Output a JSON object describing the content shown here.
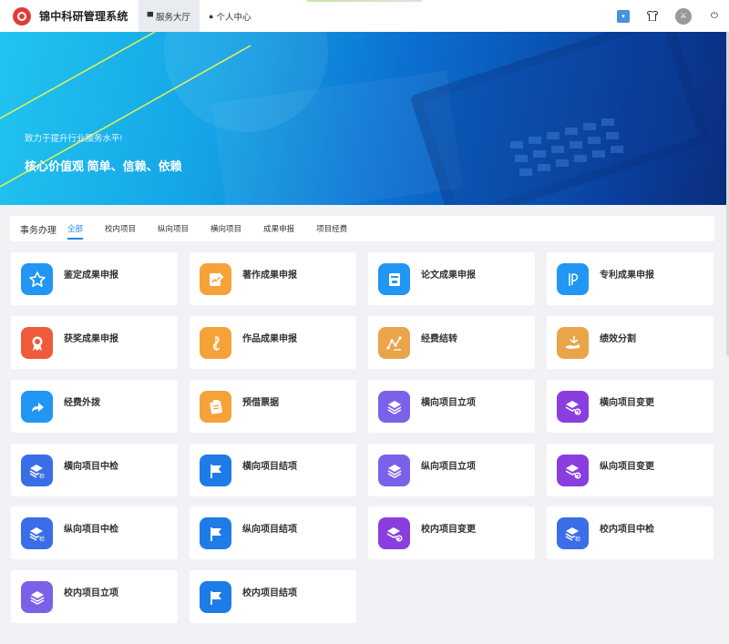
{
  "app": {
    "title": "锦中科研管理系统"
  },
  "nav": [
    {
      "label": "服务大厅",
      "icon": "monitor-icon",
      "active": true
    },
    {
      "label": "个人中心",
      "icon": "user-icon",
      "active": false
    }
  ],
  "header_icons": [
    "dropdown-box-icon",
    "shirt-icon",
    "avatar",
    "power-icon"
  ],
  "banner": {
    "subtitle": "致力于提升行业服务水平!",
    "headline": "核心价值观 简单、信赖、依赖"
  },
  "tabs": {
    "title": "事务办理",
    "filters": [
      "全部",
      "校内项目",
      "纵向项目",
      "横向项目",
      "成果申报",
      "项目经费"
    ],
    "active_index": 0
  },
  "services": [
    {
      "label": "鉴定成果申报",
      "icon": "star-icon",
      "color": "#2196f3"
    },
    {
      "label": "著作成果申报",
      "icon": "edit-book-icon",
      "color": "#f5a23a"
    },
    {
      "label": "论文成果申报",
      "icon": "paper-icon",
      "color": "#2196f3"
    },
    {
      "label": "专利成果申报",
      "icon": "patent-icon",
      "color": "#2196f3"
    },
    {
      "label": "获奖成果申报",
      "icon": "medal-icon",
      "color": "#ee5a3b"
    },
    {
      "label": "作品成果申报",
      "icon": "music-icon",
      "color": "#f5a23a"
    },
    {
      "label": "经费结转",
      "icon": "chart-line-icon",
      "color": "#eaa44a"
    },
    {
      "label": "绩效分割",
      "icon": "hand-money-icon",
      "color": "#eaa44a"
    },
    {
      "label": "经费外拨",
      "icon": "share-arrow-icon",
      "color": "#2196f3"
    },
    {
      "label": "预借票据",
      "icon": "clipboard-icon",
      "color": "#f5a23a"
    },
    {
      "label": "横向项目立项",
      "icon": "layers-icon",
      "color": "#7b61e8"
    },
    {
      "label": "横向项目变更",
      "icon": "layers-change-icon",
      "color": "#8a3ee0"
    },
    {
      "label": "横向项目中检",
      "icon": "layers-check-icon",
      "color": "#3a6ee8"
    },
    {
      "label": "横向项目结项",
      "icon": "flag-icon",
      "color": "#1f7ce6"
    },
    {
      "label": "纵向项目立项",
      "icon": "layers-icon",
      "color": "#7b61e8"
    },
    {
      "label": "纵向项目变更",
      "icon": "layers-change-icon",
      "color": "#8a3ee0"
    },
    {
      "label": "纵向项目中检",
      "icon": "layers-check-icon",
      "color": "#3a6ee8"
    },
    {
      "label": "纵向项目结项",
      "icon": "flag-icon",
      "color": "#1f7ce6"
    },
    {
      "label": "校内项目变更",
      "icon": "layers-change-icon",
      "color": "#8a3ee0"
    },
    {
      "label": "校内项目中检",
      "icon": "layers-check-icon",
      "color": "#3a6ee8"
    },
    {
      "label": "校内项目立项",
      "icon": "layers-icon",
      "color": "#7b61e8"
    },
    {
      "label": "校内项目结项",
      "icon": "flag-icon",
      "color": "#1f7ce6"
    }
  ]
}
